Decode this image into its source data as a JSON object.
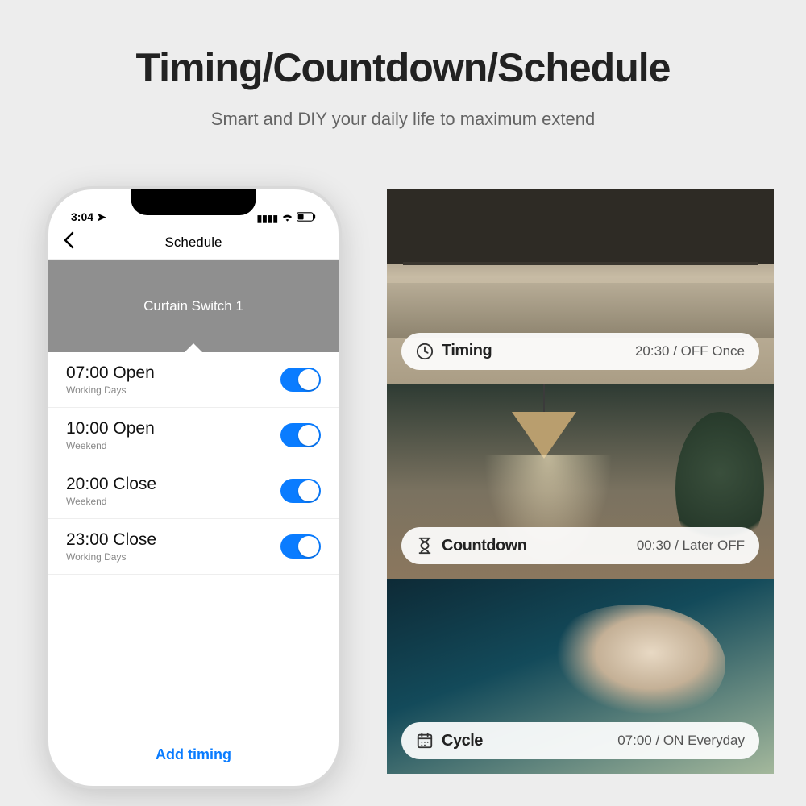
{
  "title": "Timing/Countdown/Schedule",
  "subtitle": "Smart and DIY your daily life to maximum extend",
  "phone": {
    "status_time": "3:04",
    "header_title": "Schedule",
    "device_name": "Curtain Switch 1",
    "schedule": [
      {
        "time": "07:00",
        "action": "Open",
        "days": "Working Days"
      },
      {
        "time": "10:00",
        "action": "Open",
        "days": "Weekend"
      },
      {
        "time": "20:00",
        "action": "Close",
        "days": "Weekend"
      },
      {
        "time": "23:00",
        "action": "Close",
        "days": "Working Days"
      }
    ],
    "add_label": "Add timing"
  },
  "scenes": [
    {
      "label": "Timing",
      "value": "20:30 / OFF Once"
    },
    {
      "label": "Countdown",
      "value": "00:30 / Later OFF"
    },
    {
      "label": "Cycle",
      "value": "07:00 / ON Everyday"
    }
  ]
}
